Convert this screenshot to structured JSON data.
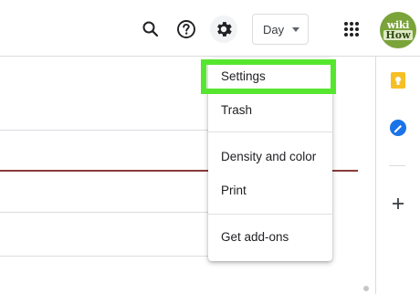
{
  "toolbar": {
    "view_selector_label": "Day",
    "icons": [
      "search-icon",
      "help-icon",
      "settings-gear-icon",
      "apps-grid-icon"
    ]
  },
  "account": {
    "avatar_line1": "wiki",
    "avatar_line2": "How"
  },
  "settings_menu": {
    "items": [
      {
        "label": "Settings",
        "highlighted": true
      },
      {
        "label": "Trash"
      },
      {
        "label": "Density and color"
      },
      {
        "label": "Print"
      },
      {
        "label": "Get add-ons"
      }
    ]
  },
  "side_panel": {
    "icons": [
      "keep-icon",
      "tasks-icon",
      "add-icon"
    ],
    "colors": {
      "keep": "#f6bf26",
      "tasks": "#1a73e8"
    }
  },
  "colors": {
    "highlight_outline": "#57e62f",
    "current_time_line": "#8a3b3b",
    "divider": "#dadce0"
  }
}
